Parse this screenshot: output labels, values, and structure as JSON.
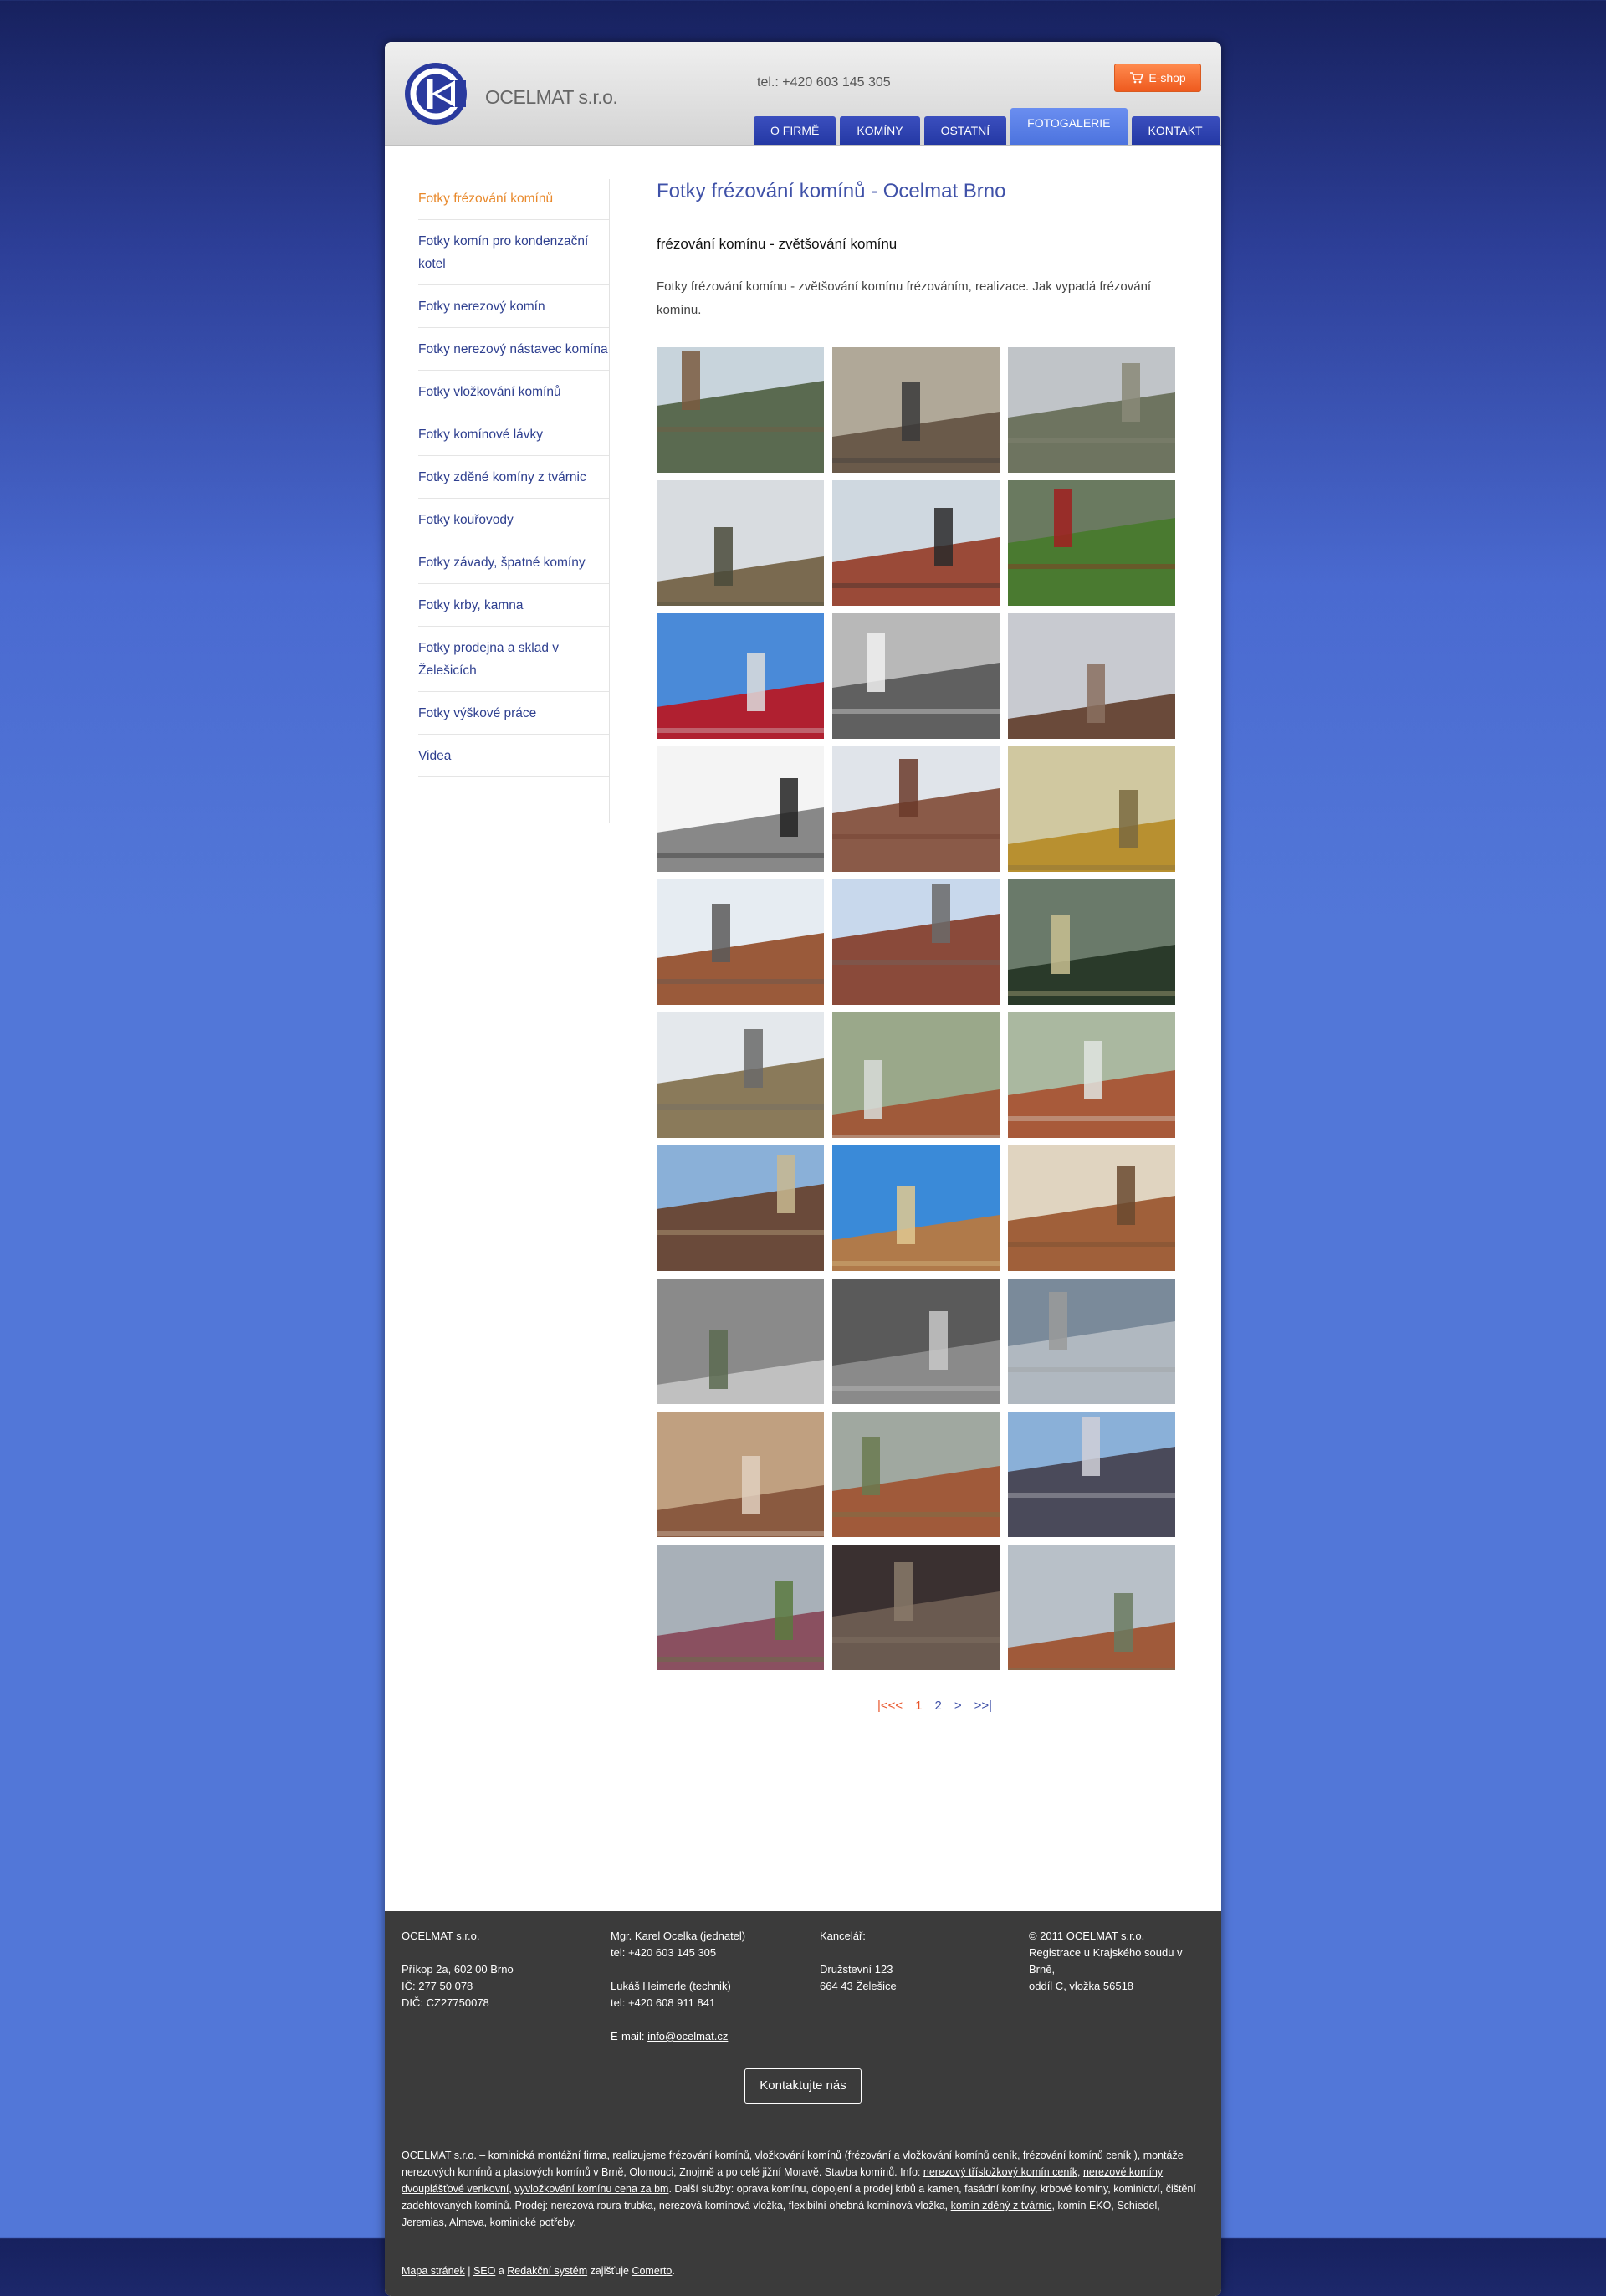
{
  "header": {
    "company_name": "OCELMAT s.r.o.",
    "phone": "tel.: +420 603 145 305",
    "eshop_label": "E-shop",
    "nav": [
      {
        "label": "O firmě",
        "active": false
      },
      {
        "label": "Komíny",
        "active": false
      },
      {
        "label": "Ostatní",
        "active": false
      },
      {
        "label": "Fotogalerie",
        "active": true
      },
      {
        "label": "Kontakt",
        "active": false
      }
    ]
  },
  "sidebar": {
    "items": [
      {
        "label": "Fotky frézování komínů",
        "active": true
      },
      {
        "label": "Fotky komín pro kondenzační kotel",
        "active": false
      },
      {
        "label": "Fotky nerezový komín",
        "active": false
      },
      {
        "label": "Fotky nerezový nástavec komína",
        "active": false
      },
      {
        "label": "Fotky vložkování komínů",
        "active": false
      },
      {
        "label": "Fotky komínové lávky",
        "active": false
      },
      {
        "label": "Fotky zděné komíny z tvárnic",
        "active": false
      },
      {
        "label": "Fotky kouřovody",
        "active": false
      },
      {
        "label": "Fotky závady, špatné komíny",
        "active": false
      },
      {
        "label": "Fotky krby, kamna",
        "active": false
      },
      {
        "label": "Fotky prodejna a sklad v Želešicích",
        "active": false
      },
      {
        "label": "Fotky výškové práce",
        "active": false
      },
      {
        "label": "Videa",
        "active": false
      }
    ]
  },
  "main": {
    "title": "Fotky frézování komínů - Ocelmat Brno",
    "subtitle": "frézování komínu - zvětšování komínu",
    "intro": "Fotky frézování komínu - zvětšování komínu frézováním, realizace. Jak vypadá frézování komínu.",
    "photo_count": 30
  },
  "pager": {
    "first": "|<<<",
    "pages": [
      "1",
      "2"
    ],
    "current": "1",
    "next": ">",
    "last": ">>|"
  },
  "footer": {
    "col1": [
      "OCELMAT s.r.o.",
      "",
      "Příkop 2a, 602 00 Brno",
      "IČ: 277 50 078",
      "DIČ: CZ27750078"
    ],
    "col2": [
      "Mgr. Karel Ocelka (jednatel)",
      "tel: +420 603 145 305",
      "",
      "Lukáš Heimerle (technik)",
      "tel: +420 608 911 841",
      "",
      "E-mail:"
    ],
    "email": "info@ocelmat.cz",
    "col3": [
      "Kancelář:",
      "",
      "Družstevní 123",
      "664 43 Želešice"
    ],
    "col4": [
      "© 2011 OCELMAT s.r.o.",
      "Registrace u Krajského soudu v Brně,",
      "oddíl C, vložka 56518"
    ],
    "contact_button": "Kontaktujte nás",
    "seo": {
      "t1": "OCELMAT s.r.o. – kominická montážní firma, realizujeme frézování komínů, vložkování komínů (",
      "l1": "frézování a vložkování komínů ceník",
      "t2": ", ",
      "l2": "frézování komínů ceník ",
      "t3": "), montáže nerezových komínů a plastových komínů v Brně, Olomouci, Znojmě a po celé jižní Moravě. Stavba komínů. Info: ",
      "l3": "nerezový třísložkový komín ceník",
      "t4": ", ",
      "l4": "nerezové komíny dvouplášťové venkovní",
      "t5": ", ",
      "l5": "vyvložkování komínu cena za bm",
      "t6": ". Další služby: oprava komínu, dopojení a prodej krbů a kamen, fasádní komíny, krbové komíny, kominictví, čištění zadehtovaných komínů. Prodej: nerezová roura trubka, nerezová komínová vložka, flexibilní ohebná komínová vložka, ",
      "l6": "komín zděný z tvárnic",
      "t7": ", komín EKO, Schiedel, Jeremias, Almeva, kominické potřeby."
    },
    "bottom": {
      "sitemap": "Mapa stránek",
      "sep": " | ",
      "seo": "SEO",
      "and": " a ",
      "cms": "Redakční systém",
      "provided": " zajišťuje ",
      "vendor": "Comerto",
      "end": "."
    }
  },
  "colors": {
    "nav_tab": "#2f43b1",
    "nav_active": "#5a80e6",
    "eshop": "#f26a2e",
    "sidebar_active": "#e8882a",
    "title": "#3f51a8",
    "footer_bg": "#3b3b3b"
  },
  "icons": {
    "logo": "ocelmat-logo-icon",
    "cart": "cart-icon"
  }
}
